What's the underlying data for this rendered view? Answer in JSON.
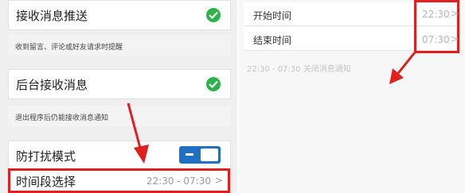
{
  "left": {
    "receive_push": {
      "title": "接收消息推送",
      "caption": "收到留言、评论或好友请求时提醒"
    },
    "background_receive": {
      "title": "后台接收消息",
      "caption": "退出程序后仍能接收消息通知"
    },
    "dnd": {
      "title": "防打扰模式"
    },
    "time_range": {
      "title": "时间段选择",
      "value": "22:30 - 07:30",
      "chevron": ">"
    }
  },
  "right": {
    "start": {
      "title": "开始时间",
      "value": "22:30",
      "chevron": ">"
    },
    "end": {
      "title": "结束时间",
      "value": "07:30",
      "chevron": ">"
    },
    "note": "22:30 - 07:30 关闭消息通知"
  },
  "colors": {
    "check": "#2bb34a",
    "toggle": "#1f6fc2",
    "highlight": "#e0201e"
  },
  "icons": [
    "check-icon",
    "toggle-switch",
    "chevron-right-icon",
    "red-arrow-annotation"
  ]
}
